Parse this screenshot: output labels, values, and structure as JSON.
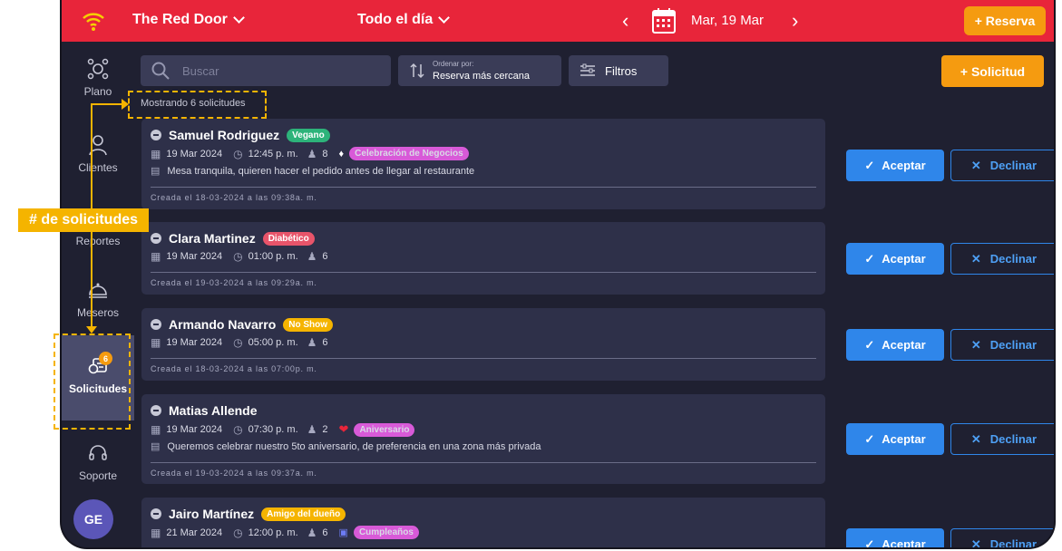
{
  "colors": {
    "brand_red": "#e8253a",
    "accent_orange": "#f59b10",
    "accept_blue": "#2f86ea",
    "annotation_yellow": "#f5b400"
  },
  "topbar": {
    "venue": "The Red Door",
    "range": "Todo el día",
    "date": "Mar, 19 Mar",
    "reserva_label": "+ Reserva"
  },
  "sidebar": {
    "items": [
      {
        "label": "Plano",
        "icon": "floor-plan-icon"
      },
      {
        "label": "Clientes",
        "icon": "user-icon"
      },
      {
        "label": "Reportes",
        "icon": "reports-icon"
      },
      {
        "label": "Meseros",
        "icon": "waiter-icon"
      },
      {
        "label": "Solicitudes",
        "icon": "requests-icon",
        "badge": "6",
        "active": true
      },
      {
        "label": "Soporte",
        "icon": "headset-icon"
      }
    ],
    "avatar": "GE"
  },
  "toolbar": {
    "search_placeholder": "Buscar",
    "sort_label": "Ordenar por:",
    "sort_value": "Reserva más cercana",
    "filters_label": "Filtros",
    "new_request_label": "+ Solicitud"
  },
  "count_text": "Mostrando 6 solicitudes",
  "annotation_label": "# de solicitudes",
  "buttons": {
    "accept": "Aceptar",
    "decline": "Declinar"
  },
  "requests": [
    {
      "name": "Samuel Rodriguez",
      "tag": "Vegano",
      "tag_color": "#2db37a",
      "date": "19 Mar 2024",
      "time": "12:45 p. m.",
      "guests": "8",
      "occasion": "Celebración de Negocios",
      "occasion_icon": "tag-icon",
      "note": "Mesa tranquila, quieren hacer el pedido antes de llegar al restaurante",
      "created": "Creada el 18-03-2024 a las 09:38a. m."
    },
    {
      "name": "Clara Martinez",
      "tag": "Diabético",
      "tag_color": "#e8546a",
      "date": "19 Mar 2024",
      "time": "01:00 p. m.",
      "guests": "6",
      "created": "Creada el 19-03-2024 a las 09:29a. m."
    },
    {
      "name": "Armando Navarro",
      "tag": "No Show",
      "tag_color": "#f5b400",
      "date": "19 Mar 2024",
      "time": "05:00 p. m.",
      "guests": "6",
      "created": "Creada el 18-03-2024 a las 07:00p. m."
    },
    {
      "name": "Matias Allende",
      "date": "19 Mar 2024",
      "time": "07:30 p. m.",
      "guests": "2",
      "occasion": "Aniversario",
      "occasion_icon": "heart-icon",
      "note": "Queremos celebrar nuestro 5to aniversario, de preferencia en una zona más privada",
      "created": "Creada el 19-03-2024 a las 09:37a. m."
    },
    {
      "name": "Jairo Martínez",
      "tag": "Amigo del dueño",
      "tag_color": "#f5b400",
      "date": "21 Mar 2024",
      "time": "12:00 p. m.",
      "guests": "6",
      "occasion": "Cumpleaños",
      "occasion_icon": "gift-icon"
    }
  ]
}
